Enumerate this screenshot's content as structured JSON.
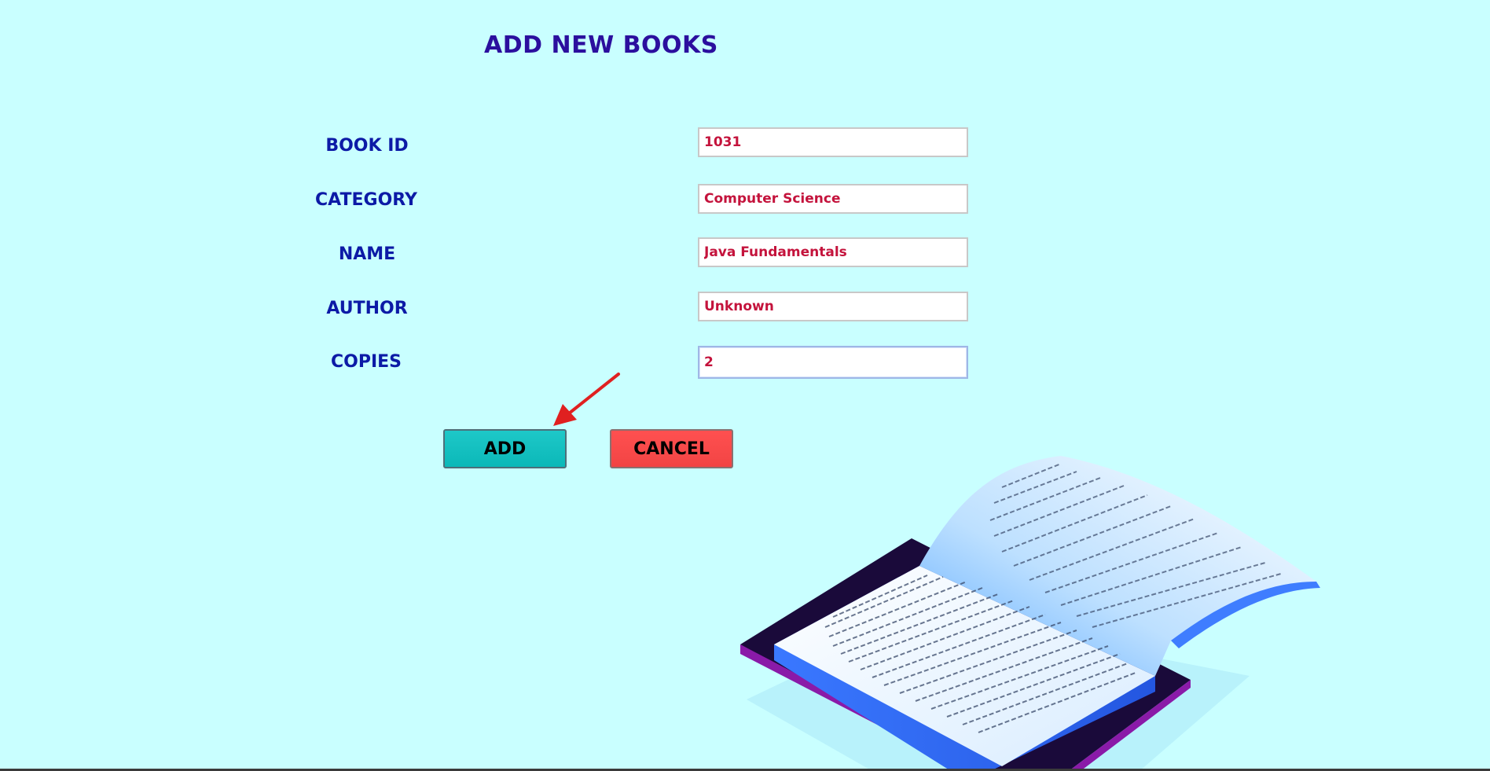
{
  "page": {
    "title": "ADD NEW BOOKS"
  },
  "form": {
    "fields": [
      {
        "label": "BOOK ID",
        "value": "1031"
      },
      {
        "label": "CATEGORY",
        "value": "Computer Science"
      },
      {
        "label": "NAME",
        "value": "Java Fundamentals"
      },
      {
        "label": "AUTHOR",
        "value": "Unknown"
      },
      {
        "label": "COPIES",
        "value": "2"
      }
    ],
    "focused_field": "COPIES"
  },
  "buttons": {
    "add_label": "ADD",
    "cancel_label": "CANCEL"
  },
  "colors": {
    "background": "#c9ffff",
    "title": "#2b0f9e",
    "label": "#0c1aa6",
    "input_text": "#c4133c",
    "add_button": "#12c0c0",
    "cancel_button": "#f94a4a",
    "annotation_arrow": "#e02020"
  },
  "icons": {
    "annotation": "red-arrow-icon",
    "illustration": "open-book-on-tablet-illustration"
  }
}
